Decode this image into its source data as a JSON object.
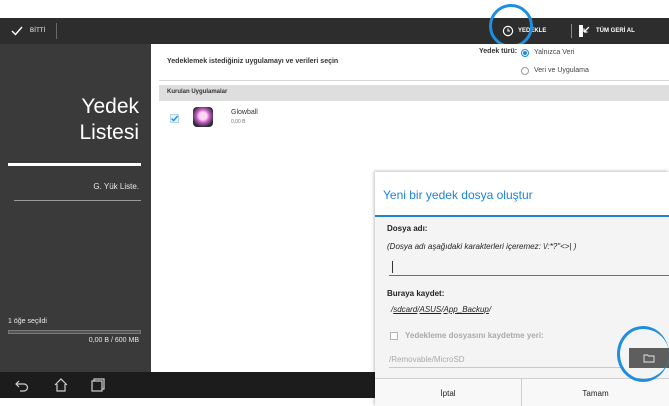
{
  "action_bar": {
    "done_label": "BİTTİ",
    "backup_label": "YEDEKLE",
    "restore_label": "TÜM GERİ AL"
  },
  "sidebar": {
    "title_line1": "Yedek",
    "title_line2": "Listesi",
    "tab_label": "G. Yük Liste.",
    "selected_count": "1 öğe seçildi",
    "size_summary": "0,00 B / 600 MB"
  },
  "main": {
    "instruction": "Yedeklemek istediğiniz uygulamayı ve verileri seçin",
    "backup_type_label": "Yedek türü:",
    "backup_type_options": [
      {
        "label": "Yalnızca Veri",
        "selected": true
      },
      {
        "label": "Veri ve Uygulama",
        "selected": false
      }
    ],
    "section_title": "Kurulan Uygulamalar",
    "apps": [
      {
        "name": "Glowball",
        "size": "0,00 B",
        "checked": true
      }
    ]
  },
  "dialog": {
    "title": "Yeni bir yedek dosya oluştur",
    "file_name_label": "Dosya adı:",
    "file_name_note": "(Dosya adı aşağıdaki karakterleri içeremez: \\/:*?\"<>| )",
    "file_name_value": "",
    "save_to_label": "Buraya kaydet:",
    "save_path_prefix": "/",
    "save_path_parts": [
      "sdcard",
      "ASUS",
      "App_Backup"
    ],
    "save_path_sep": "/",
    "save_path_suffix": "/",
    "alt_location_label": "Yedekleme dosyasını kaydetme yeri:",
    "alt_location_checked": false,
    "alt_location_placeholder": "/Removable/MicroSD",
    "cancel_label": "İptal",
    "ok_label": "Tamam"
  },
  "colors": {
    "accent": "#1b84d6",
    "highlight_ring": "#1f8ee0",
    "sidebar_bg": "#3a3a3a",
    "topbar_bg": "#2d2d2d"
  }
}
